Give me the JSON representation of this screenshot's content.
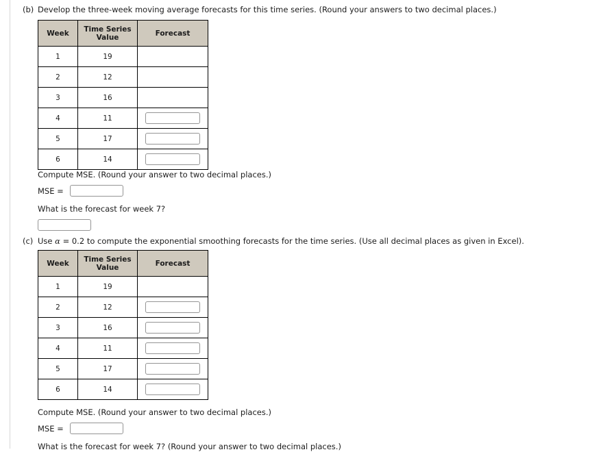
{
  "document": {
    "background_color": "#ffffff",
    "text_color": "#1b1b1b",
    "table_header_bg": "#cfc9bd",
    "table_border_color": "#000000",
    "input_border_color": "#949494"
  },
  "parts": [
    {
      "label": "(b)",
      "prompt": "Develop the three-week moving average forecasts for this time series. (Round your answers to two decimal places.)",
      "table": {
        "columns": [
          "Week",
          "Time Series Value",
          "Forecast"
        ],
        "rows": [
          {
            "week": "1",
            "value": "19",
            "forecast_input": false,
            "forecast_value": ""
          },
          {
            "week": "2",
            "value": "12",
            "forecast_input": false,
            "forecast_value": ""
          },
          {
            "week": "3",
            "value": "16",
            "forecast_input": false,
            "forecast_value": ""
          },
          {
            "week": "4",
            "value": "11",
            "forecast_input": true,
            "forecast_value": ""
          },
          {
            "week": "5",
            "value": "17",
            "forecast_input": true,
            "forecast_value": ""
          },
          {
            "week": "6",
            "value": "14",
            "forecast_input": true,
            "forecast_value": ""
          }
        ]
      },
      "mse_prompt": "Compute MSE. (Round your answer to two decimal places.)",
      "mse_label": "MSE =",
      "mse_value": "",
      "week7_prompt": "What is the forecast for week 7?",
      "week7_value": ""
    },
    {
      "label": "(c)",
      "prompt_before_alpha": "Use ",
      "alpha_symbol": "α",
      "prompt_after_alpha": " = 0.2 to compute the exponential smoothing forecasts for the time series. (Use all decimal places as given in Excel).",
      "table": {
        "columns": [
          "Week",
          "Time Series Value",
          "Forecast"
        ],
        "rows": [
          {
            "week": "1",
            "value": "19",
            "forecast_input": false,
            "forecast_value": ""
          },
          {
            "week": "2",
            "value": "12",
            "forecast_input": true,
            "forecast_value": ""
          },
          {
            "week": "3",
            "value": "16",
            "forecast_input": true,
            "forecast_value": ""
          },
          {
            "week": "4",
            "value": "11",
            "forecast_input": true,
            "forecast_value": ""
          },
          {
            "week": "5",
            "value": "17",
            "forecast_input": true,
            "forecast_value": ""
          },
          {
            "week": "6",
            "value": "14",
            "forecast_input": true,
            "forecast_value": ""
          }
        ]
      },
      "mse_prompt": "Compute MSE. (Round your answer to two decimal places.)",
      "mse_label": "MSE =",
      "mse_value": "",
      "week7_prompt": "What is the forecast for week 7? (Round your answer to two decimal places.)"
    }
  ]
}
